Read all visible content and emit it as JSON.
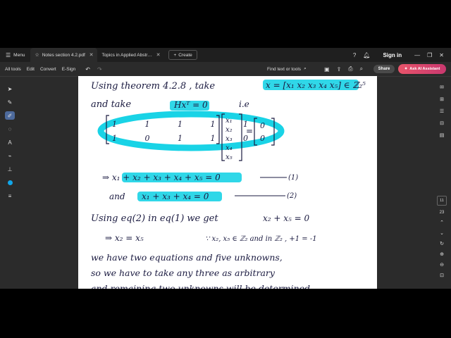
{
  "tabbar": {
    "menu_label": "Menu",
    "tabs": [
      {
        "label": "Notes section 4.2.pdf",
        "active": true
      },
      {
        "label": "Topics in Applied Abstract Algebr...",
        "active": false
      }
    ],
    "create_label": "Create",
    "signin_label": "Sign in"
  },
  "toolbar": {
    "all_tools": "All tools",
    "edit": "Edit",
    "convert": "Convert",
    "esign": "E-Sign",
    "find_label": "Find text or tools",
    "share_label": "Share",
    "ask_ai_label": "Ask AI Assistant"
  },
  "document": {
    "lines": {
      "l1a": "Using theorem 4.2.8 , take",
      "l1b": "x = [x₁ x₂ x₃ x₄ x₅] ∈ ℤ₂⁵",
      "l2a": "and take",
      "l2b": "Hxᵀ = 0",
      "l2c": "i.e",
      "row1": "1  1  1  1  1",
      "row2": "1  0  1  1  0",
      "eq1": "⇒  x₁ + x₂ + x₃ + x₄ + x₅ = 0",
      "eq1_tag": "(1)",
      "eq2a": "and",
      "eq2b": "x₁ + x₃ + x₄ = 0",
      "eq2_tag": "(2)",
      "l5a": "Using eq(2) in eq(1) we get",
      "l5b": "x₂ + x₅ = 0",
      "l6a": "⇒  x₂ = x₅",
      "l6b": "∵ x₂, x₅ ∈ ℤ₂  and in ℤ₂ , +1 = -1",
      "l7": "we have two equations and five unknowns,",
      "l8": "so we have to take any three as arbitrary",
      "l9": "and remaining two unknowns will be determined"
    },
    "vector_entries": [
      "x₁",
      "x₂",
      "x₃",
      "x₄",
      "x₅"
    ],
    "zero_entries": [
      "0",
      "0"
    ],
    "highlight_color": "#19d3e6",
    "ink_color": "#1a1a40"
  },
  "rightrail": {
    "page_box": "11",
    "page_number": "23"
  },
  "colors": {
    "tool_selected": "#4d6a9c",
    "color_dot": "#11a6e9",
    "ai_button": "#e8546a"
  }
}
